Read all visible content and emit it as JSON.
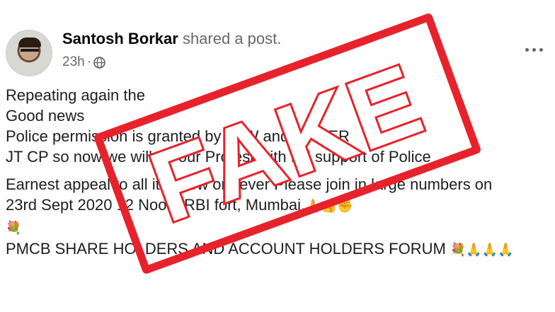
{
  "post": {
    "author": "Santosh Borkar",
    "action": " shared a post.",
    "timestamp": "23h",
    "privacy_icon": "globe-icon",
    "menu_icon": "more-options-icon",
    "lines": [
      "Repeating again the",
      "Good news",
      "Police permission is granted by LAW and ORDER",
      "JT CP so now we will do our Protest with full support of Police ."
    ],
    "appeal_lines": [
      "Earnest appeal to all it is now or never Please join in large numbers on",
      "23rd Sept 2020 12 Noon. RBI fort, Mumbai."
    ],
    "appeal_emojis": "🙏👍✊",
    "flower_emoji": "💐",
    "forum_line": "PMCB SHARE HOLDERS AND ACCOUNT HOLDERS FORUM",
    "forum_emojis": "💐🙏🙏🙏"
  },
  "stamp": {
    "text": "FAKE",
    "color": "#e8222b"
  }
}
